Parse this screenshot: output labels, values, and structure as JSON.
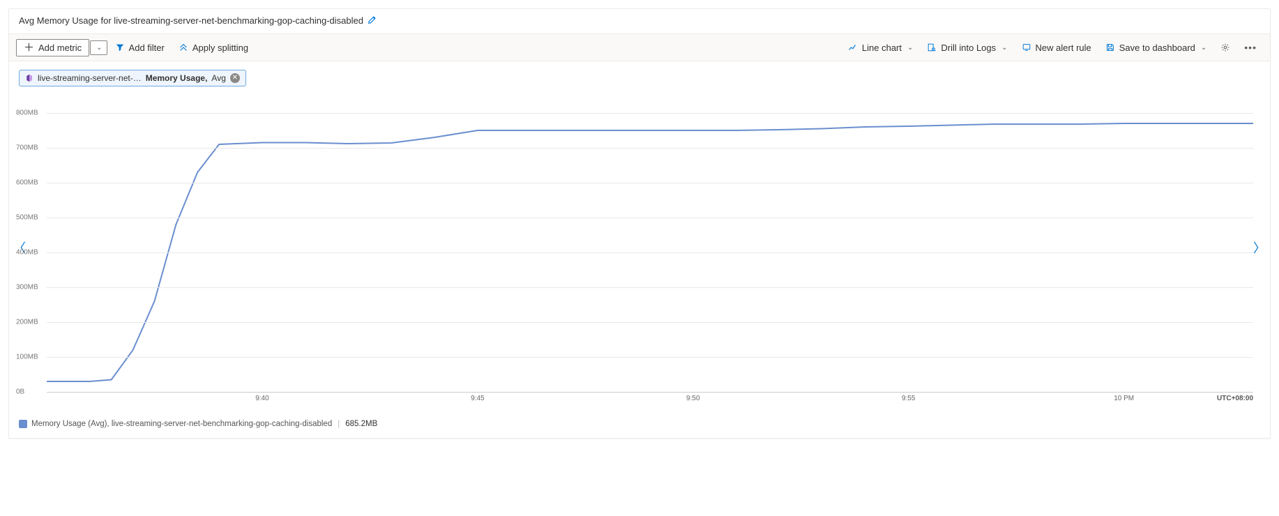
{
  "header": {
    "title": "Avg Memory Usage for live-streaming-server-net-benchmarking-gop-caching-disabled"
  },
  "toolbar": {
    "add_metric": "Add metric",
    "add_filter": "Add filter",
    "apply_splitting": "Apply splitting",
    "line_chart": "Line chart",
    "drill_logs": "Drill into Logs",
    "new_alert": "New alert rule",
    "save_dashboard": "Save to dashboard"
  },
  "metric_pill": {
    "resource_trunc": "live-streaming-server-net-…",
    "metric": "Memory Usage,",
    "agg": "Avg"
  },
  "legend": {
    "label": "Memory Usage (Avg), live-streaming-server-net-benchmarking-gop-caching-disabled",
    "value": "685.2MB"
  },
  "timezone": "UTC+08:00",
  "chart_data": {
    "type": "line",
    "title": "Avg Memory Usage for live-streaming-server-net-benchmarking-gop-caching-disabled",
    "xlabel": "",
    "ylabel": "",
    "ylim": [
      0,
      800
    ],
    "y_ticks": [
      {
        "v": 0,
        "label": "0B"
      },
      {
        "v": 100,
        "label": "100MB"
      },
      {
        "v": 200,
        "label": "200MB"
      },
      {
        "v": 300,
        "label": "300MB"
      },
      {
        "v": 400,
        "label": "400MB"
      },
      {
        "v": 500,
        "label": "500MB"
      },
      {
        "v": 600,
        "label": "600MB"
      },
      {
        "v": 700,
        "label": "700MB"
      },
      {
        "v": 800,
        "label": "800MB"
      }
    ],
    "xlim": [
      0,
      28
    ],
    "x_ticks": [
      {
        "v": 5,
        "label": "9:40"
      },
      {
        "v": 10,
        "label": "9:45"
      },
      {
        "v": 15,
        "label": "9:50"
      },
      {
        "v": 20,
        "label": "9:55"
      },
      {
        "v": 25,
        "label": "10 PM"
      }
    ],
    "series": [
      {
        "name": "Memory Usage (Avg)",
        "color": "#6a8ecf",
        "x": [
          0,
          0.5,
          1,
          1.5,
          2,
          2.5,
          3,
          3.5,
          4,
          5,
          6,
          7,
          8,
          9,
          10,
          11,
          12,
          13,
          14,
          15,
          16,
          17,
          18,
          19,
          20,
          21,
          22,
          23,
          24,
          25,
          26,
          27,
          28
        ],
        "values": [
          30,
          30,
          30,
          35,
          120,
          260,
          480,
          630,
          710,
          715,
          715,
          712,
          714,
          730,
          750,
          750,
          750,
          750,
          750,
          750,
          750,
          752,
          755,
          760,
          762,
          765,
          768,
          768,
          768,
          770,
          770,
          770,
          770
        ]
      }
    ]
  }
}
